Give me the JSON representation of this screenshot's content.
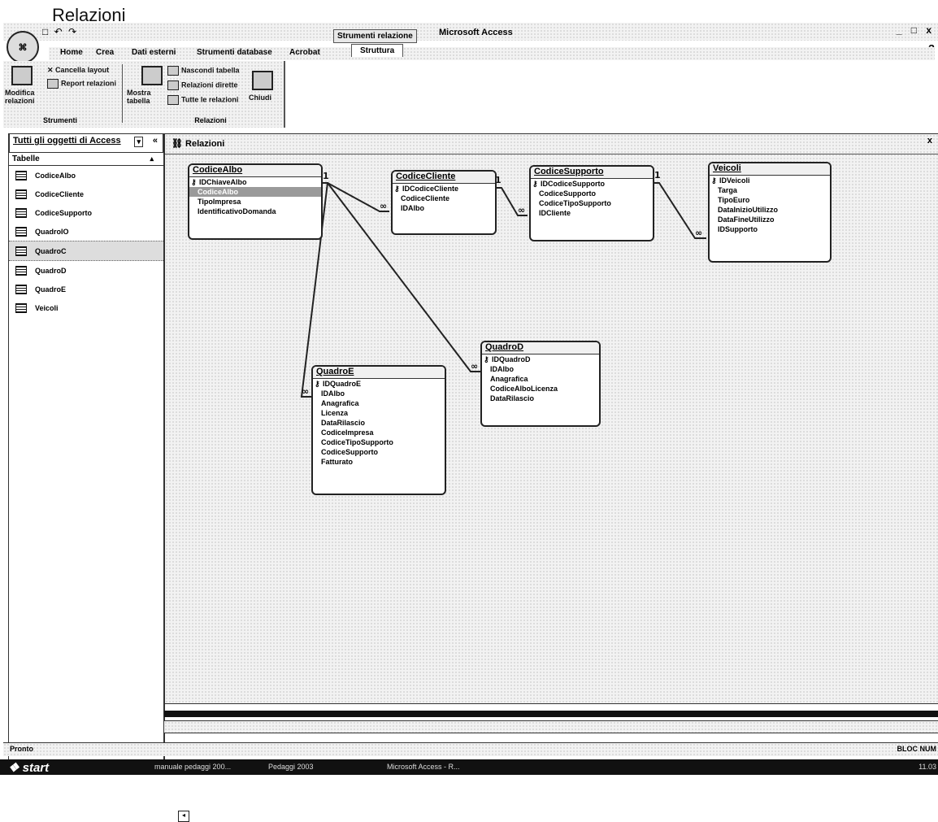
{
  "caption": "Relazioni",
  "window": {
    "office_button": "⌘",
    "quick_access": "□ ↶ ↷",
    "context_group": "Strumenti relazione",
    "app_title": "Microsoft Access",
    "controls": "_ □ x"
  },
  "tabs": [
    {
      "label": "Home"
    },
    {
      "label": "Crea"
    },
    {
      "label": "Dati esterni"
    },
    {
      "label": "Strumenti database"
    },
    {
      "label": "Acrobat"
    },
    {
      "label": "Struttura"
    }
  ],
  "ribbon": {
    "modifica_relazioni": "Modifica relazioni",
    "cancella_layout": "Cancella layout",
    "report_relazioni": "Report relazioni",
    "group_strumenti": "Strumenti",
    "mostra_tabella": "Mostra tabella",
    "nascondi_tabella": "Nascondi tabella",
    "relazioni_dirette": "Relazioni dirette",
    "tutte_le_relazioni": "Tutte le relazioni",
    "chiudi": "Chiudi",
    "group_relazioni": "Relazioni"
  },
  "nav": {
    "header": "Tutti gli oggetti di Access",
    "section": "Tabelle",
    "items": [
      {
        "label": "CodiceAlbo"
      },
      {
        "label": "CodiceCliente"
      },
      {
        "label": "CodiceSupporto"
      },
      {
        "label": "QuadroIO"
      },
      {
        "label": "QuadroC"
      },
      {
        "label": "QuadroD"
      },
      {
        "label": "QuadroE"
      },
      {
        "label": "Veicoli"
      }
    ],
    "selected_index": 4
  },
  "document": {
    "title": "Relazioni",
    "close": "x"
  },
  "tables": {
    "codice_albo": {
      "title": "CodiceAlbo",
      "fields": [
        "IDChiaveAlbo",
        "CodiceAlbo",
        "TipoImpresa",
        "IdentificativoDomanda"
      ]
    },
    "codice_cliente": {
      "title": "CodiceCliente",
      "fields": [
        "IDCodiceCliente",
        "CodiceCliente",
        "IDAlbo"
      ]
    },
    "codice_supporto": {
      "title": "CodiceSupporto",
      "fields": [
        "IDCodiceSupporto",
        "CodiceSupporto",
        "CodiceTipoSupporto",
        "IDCliente"
      ]
    },
    "veicoli": {
      "title": "Veicoli",
      "fields": [
        "IDVeicoli",
        "Targa",
        "TipoEuro",
        "DataInizioUtilizzo",
        "DataFineUtilizzo",
        "IDSupporto"
      ]
    },
    "quadro_e": {
      "title": "QuadroE",
      "fields": [
        "IDQuadroE",
        "IDAlbo",
        "Anagrafica",
        "Licenza",
        "DataRilascio",
        "CodiceImpresa",
        "CodiceTipoSupporto",
        "CodiceSupporto",
        "Fatturato"
      ]
    },
    "quadro_d": {
      "title": "QuadroD",
      "fields": [
        "IDQuadroD",
        "IDAlbo",
        "Anagrafica",
        "CodiceAlboLicenza",
        "DataRilascio"
      ]
    }
  },
  "relation_labels": {
    "one": "1",
    "many": "∞"
  },
  "status": {
    "left": "Pronto",
    "right": "BLOC NUM"
  },
  "taskbar": {
    "start": "start",
    "tasks": [
      {
        "label": "manuale pedaggi 200..."
      },
      {
        "label": "Pedaggi 2003"
      },
      {
        "label": "Microsoft Access - R..."
      }
    ],
    "clock": "11.03"
  }
}
